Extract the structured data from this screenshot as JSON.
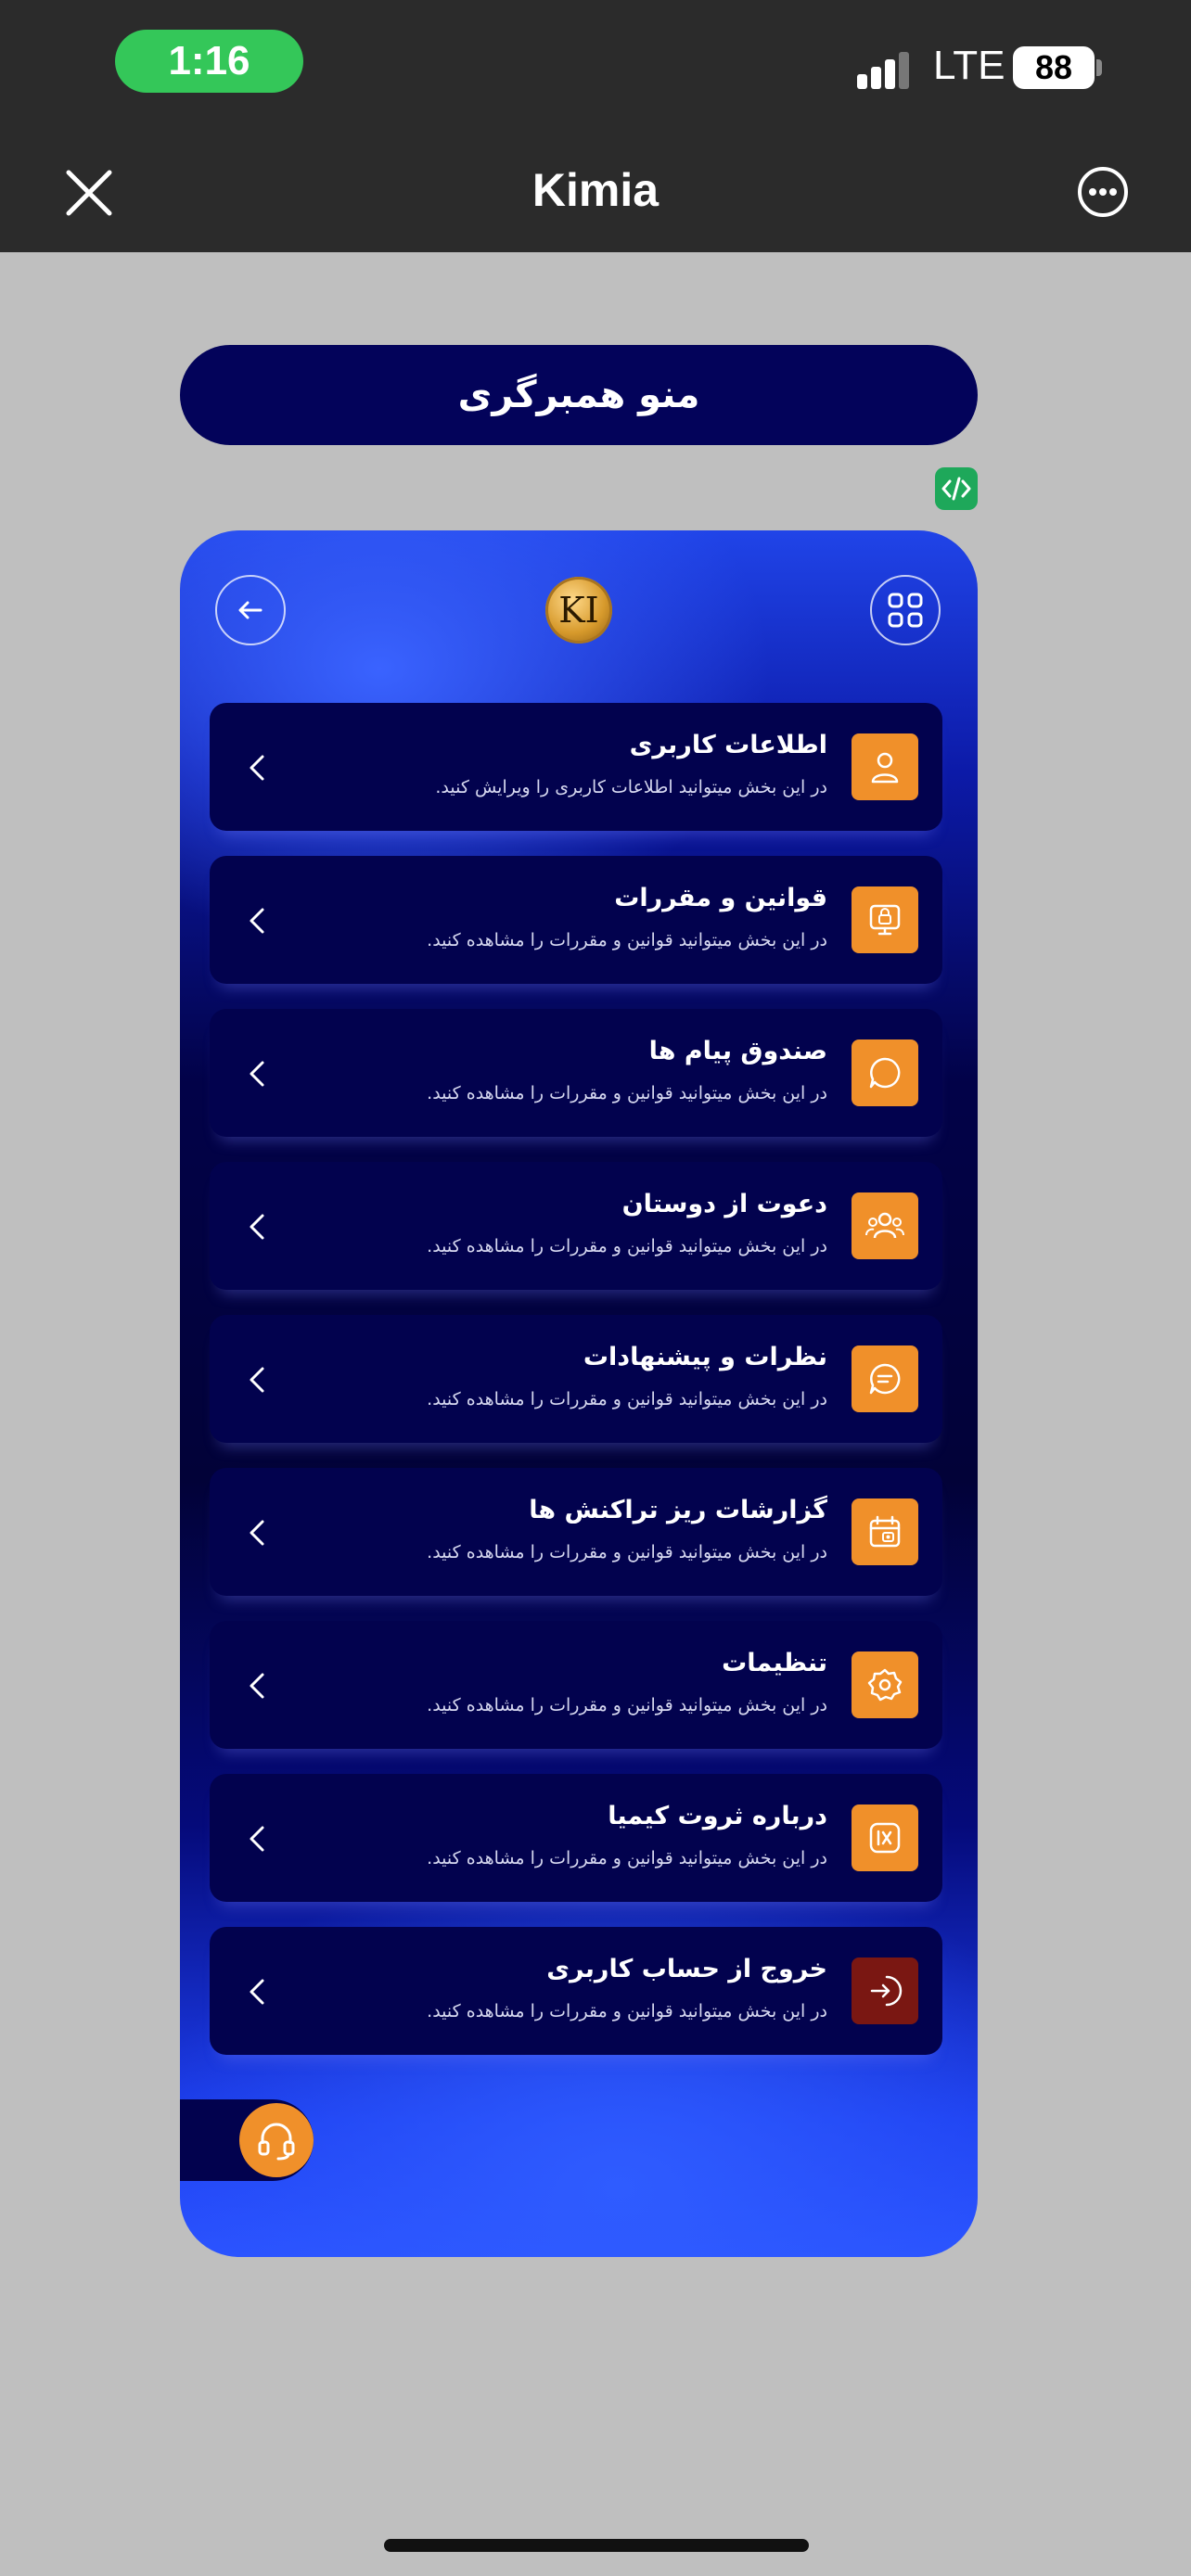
{
  "status_bar": {
    "time": "1:16",
    "network": "LTE",
    "battery": "88"
  },
  "nav": {
    "title": "Kimia",
    "close_icon": "close-icon",
    "more_icon": "more-icon"
  },
  "page": {
    "header": "منو همبرگری"
  },
  "card": {
    "logo_text": "KI",
    "menu_items": [
      {
        "title": "اطلاعات کاربری",
        "desc": "در این بخش میتوانید اطلاعات کاربری را ویرایش کنید.",
        "icon": "user-icon"
      },
      {
        "title": "قوانین و مقررات",
        "desc": "در این بخش میتوانید قوانین و مقررات را مشاهده کنید.",
        "icon": "rules-icon"
      },
      {
        "title": "صندوق پیام ها",
        "desc": "در این بخش میتوانید قوانین و مقررات را مشاهده کنید.",
        "icon": "message-icon"
      },
      {
        "title": "دعوت از دوستان",
        "desc": "در این بخش میتوانید قوانین و مقررات را مشاهده کنید.",
        "icon": "friends-icon"
      },
      {
        "title": "نظرات و پیشنهادات",
        "desc": "در این بخش میتوانید قوانین و مقررات را مشاهده کنید.",
        "icon": "comment-icon"
      },
      {
        "title": "گزارشات ریز تراکنش ها",
        "desc": "در این بخش میتوانید قوانین و مقررات را مشاهده کنید.",
        "icon": "report-icon"
      },
      {
        "title": "تنظیمات",
        "desc": "در این بخش میتوانید قوانین و مقررات را مشاهده کنید.",
        "icon": "settings-icon"
      },
      {
        "title": "درباره ثروت کیمیا",
        "desc": "در این بخش میتوانید قوانین و مقررات را مشاهده کنید.",
        "icon": "about-icon"
      },
      {
        "title": "خروج از حساب کاربری",
        "desc": "در این بخش میتوانید قوانین و مقررات را مشاهده کنید.",
        "icon": "logout-icon"
      }
    ]
  },
  "colors": {
    "accent": "#f0902a",
    "card_dark": "#02024e",
    "card_blue": "#2a52ff",
    "logout": "#7a1712"
  }
}
